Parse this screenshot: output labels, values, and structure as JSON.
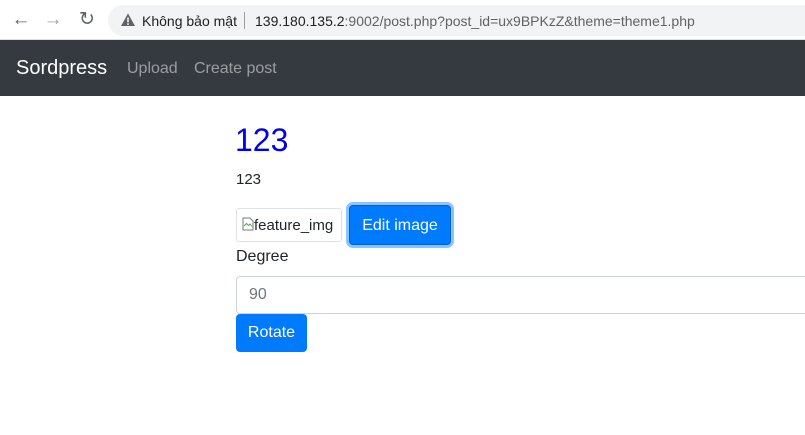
{
  "browser": {
    "security_label": "Không bảo mật",
    "url_host": "139.180.135.2",
    "url_rest": ":9002/post.php?post_id=ux9BPKzZ&theme=theme1.php"
  },
  "navbar": {
    "brand": "Sordpress",
    "links": [
      "Upload",
      "Create post"
    ]
  },
  "post": {
    "title": "123",
    "body": "123",
    "image_alt": "feature_img",
    "edit_button": "Edit image"
  },
  "rotate_form": {
    "degree_label": "Degree",
    "degree_placeholder": "90",
    "rotate_button": "Rotate"
  },
  "colors": {
    "navbar_bg": "#343a40",
    "primary": "#007bff",
    "title_link": "#0000ee"
  }
}
